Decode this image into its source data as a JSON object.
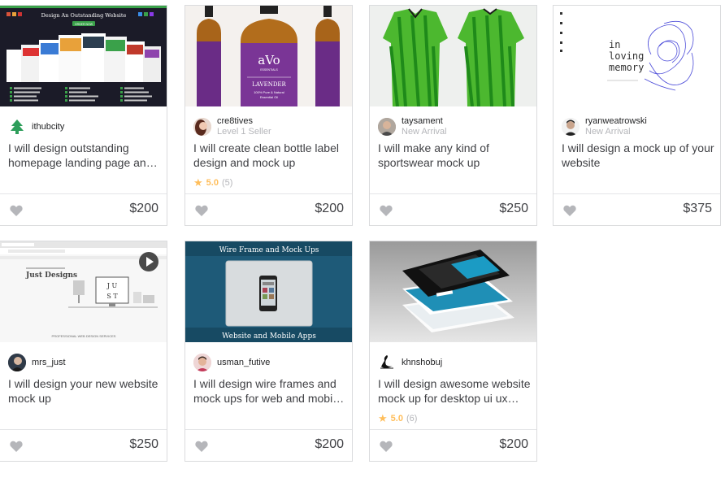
{
  "gigs": [
    {
      "seller": "ithubcity",
      "level": "",
      "title": "I will design outstanding homepage landing page and website",
      "price": "$200",
      "thumb_text": [
        "Design An Outstanding Website",
        "ORDER NOW",
        "Clean and Modern Design",
        "Mobile Friendly Design",
        "Fully Layered PSD",
        "Professional Design",
        "Contact Form",
        "Google Map",
        "100% Money Back Guarantee",
        "100% Client Satisfaction",
        "24/7 Support",
        "Unlimited revisions",
        "All Fonts PSD with deliver",
        "Quick Order Deliver"
      ]
    },
    {
      "seller": "cre8tives",
      "level": "Level 1 Seller",
      "title": "I will create clean bottle label design and mock up",
      "rating": "5.0",
      "reviews": "(5)",
      "price": "$200",
      "thumb_text": [
        "aVo",
        "ESSENTIALS",
        "LAVENDER",
        "100% Pure & Natural",
        "Essential Oil"
      ]
    },
    {
      "seller": "taysament",
      "level": "New Arrival",
      "title": "I will make any kind of sportswear mock up",
      "price": "$250"
    },
    {
      "seller": "ryanweatrowski",
      "level": "New Arrival",
      "title": "I will design a mock up of your website",
      "price": "$375",
      "thumb_text": [
        "in",
        "loving",
        "memory"
      ]
    },
    {
      "seller": "mrs_just",
      "level": "",
      "title": "I will design your new website mock up",
      "price": "$250",
      "thumb_text": [
        "Just Designs",
        "J U",
        "S T",
        "PROFESSIONAL WEB DESIGN SERVICES"
      ]
    },
    {
      "seller": "usman_futive",
      "level": "",
      "title": "I will design wire frames and mock ups for web and mobile apps",
      "price": "$200",
      "thumb_text": [
        "Wire Frame and Mock Ups",
        "Website and Mobile Apps"
      ]
    },
    {
      "seller": "khnshobuj",
      "level": "",
      "title": "I will design awesome website mock up for desktop ui ux design",
      "rating": "5.0",
      "reviews": "(6)",
      "price": "$200"
    }
  ],
  "icons": {
    "favorite": "heart-icon",
    "rating": "star-icon",
    "video": "play-icon"
  },
  "colors": {
    "star": "#ffbe5b",
    "heart": "#b5b6ba",
    "border": "#dadbdd"
  }
}
